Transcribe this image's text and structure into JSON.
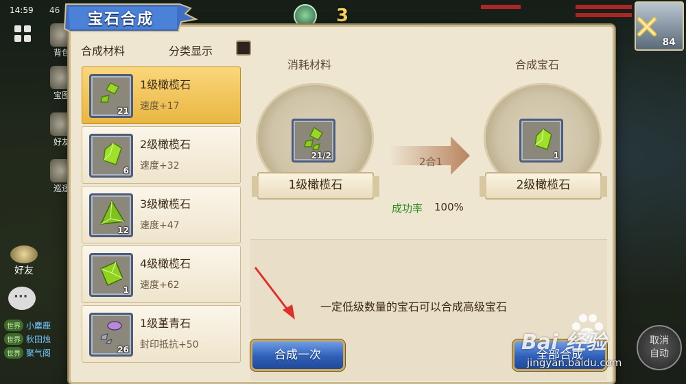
{
  "hud": {
    "time": "14:59",
    "level_badge": "46",
    "counter": "3",
    "avatar_level": "84",
    "side_icons": [
      {
        "label": "背包"
      },
      {
        "label": "宝图"
      },
      {
        "label": "好友"
      },
      {
        "label": "巡逻"
      }
    ],
    "friend_label": "好友",
    "chat": [
      {
        "tag": "世界",
        "name": "小麋鹿"
      },
      {
        "tag": "世界",
        "name": "秋田烛"
      },
      {
        "tag": "世界",
        "name": "聚气阁"
      }
    ],
    "auto_button": "取消\n自动"
  },
  "dialog": {
    "title": "宝石合成",
    "list_title": "合成材料",
    "filter_label": "分类显示",
    "filter_checked": true,
    "gems": [
      {
        "name": "1级橄榄石",
        "stat": "速度+17",
        "count": "21",
        "type": "olive-small",
        "selected": true
      },
      {
        "name": "2级橄榄石",
        "stat": "速度+32",
        "count": "6",
        "type": "olive-mid",
        "selected": false
      },
      {
        "name": "3级橄榄石",
        "stat": "速度+47",
        "count": "12",
        "type": "olive-large",
        "selected": false
      },
      {
        "name": "4级橄榄石",
        "stat": "速度+62",
        "count": "1",
        "type": "olive-xl",
        "selected": false
      },
      {
        "name": "1级堇青石",
        "stat": "封印抵抗+50",
        "count": "26",
        "type": "iolite-small",
        "selected": false
      }
    ],
    "consume_label": "消耗材料",
    "result_label": "合成宝石",
    "consume": {
      "name": "1级橄榄石",
      "count": "21/2"
    },
    "result": {
      "name": "2级橄榄石",
      "count": "1"
    },
    "ratio": "2合1",
    "success_label": "成功率",
    "success_value": "100%",
    "hint": "一定低级数量的宝石可以合成高级宝石",
    "craft_once": "合成一次",
    "craft_all": "全部合成"
  },
  "watermark": {
    "brand": "Bai 经验",
    "url": "jingyan.baidu.com"
  },
  "colors": {
    "selected_row": "#e9b642",
    "button_blue": "#2f5fb8",
    "success_green": "#2e8b1f",
    "annotation_red": "#e0302a"
  }
}
